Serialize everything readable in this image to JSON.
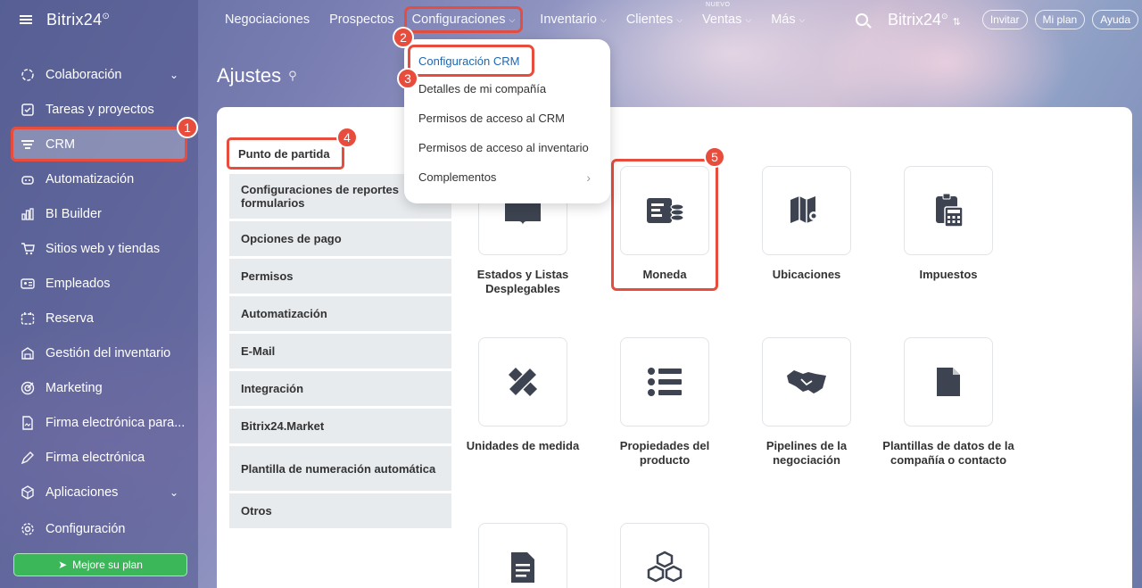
{
  "sidebar": {
    "logo": "Bitrix24",
    "items": [
      {
        "label": "Colaboración",
        "icon": "collab-icon",
        "chevron": true
      },
      {
        "label": "Tareas y proyectos",
        "icon": "tasks-icon",
        "chevron": false
      },
      {
        "label": "CRM",
        "icon": "crm-filter-icon",
        "chevron": false,
        "active": true
      },
      {
        "label": "Automatización",
        "icon": "robot-icon",
        "chevron": false
      },
      {
        "label": "BI Builder",
        "icon": "bar-chart-icon",
        "chevron": false
      },
      {
        "label": "Sitios web y tiendas",
        "icon": "cart-icon",
        "chevron": false
      },
      {
        "label": "Empleados",
        "icon": "id-card-icon",
        "chevron": false
      },
      {
        "label": "Reserva",
        "icon": "calendar-icon",
        "chevron": false
      },
      {
        "label": "Gestión del inventario",
        "icon": "box-icon",
        "chevron": false
      },
      {
        "label": "Marketing",
        "icon": "target-icon",
        "chevron": false
      },
      {
        "label": "Firma electrónica para...",
        "icon": "doc-sign-icon",
        "chevron": false
      },
      {
        "label": "Firma electrónica",
        "icon": "pen-icon",
        "chevron": false
      },
      {
        "label": "Aplicaciones",
        "icon": "cube-icon",
        "chevron": true
      },
      {
        "label": "Configuración",
        "icon": "gear-icon",
        "chevron": false
      }
    ],
    "upgrade": "Mejore su plan"
  },
  "topnav": {
    "items": [
      "Negociaciones",
      "Prospectos",
      "Configuraciones",
      "Inventario",
      "Clientes",
      "Ventas",
      "Más"
    ],
    "nuevo": "NUEVO",
    "brand": "Bitrix24",
    "invite": "Invitar",
    "myplan": "Mi plan",
    "help": "Ayuda"
  },
  "page": {
    "title": "Ajustes"
  },
  "dropdown": {
    "items": [
      "Configuración CRM",
      "Detalles de mi compañía",
      "Permisos de acceso al CRM",
      "Permisos de acceso al inventario",
      "Complementos"
    ]
  },
  "menu": {
    "items": [
      "Punto de partida",
      "Configuraciones de reportes formularios",
      "Opciones de pago",
      "Permisos",
      "Automatización",
      "E-Mail",
      "Integración",
      "Bitrix24.Market",
      "Plantilla de numeración automática",
      "Otros"
    ]
  },
  "tiles": [
    "Estados y Listas Desplegables",
    "Moneda",
    "Ubicaciones",
    "Impuestos",
    "Unidades de medida",
    "Propiedades del producto",
    "Pipelines de la negociación",
    "Plantillas de datos de la compañía o contacto"
  ],
  "badges": [
    "1",
    "2",
    "3",
    "4",
    "5"
  ],
  "colors": {
    "accent": "#e74c3c",
    "link": "#2067b0",
    "upgrade": "#3bb75a"
  }
}
